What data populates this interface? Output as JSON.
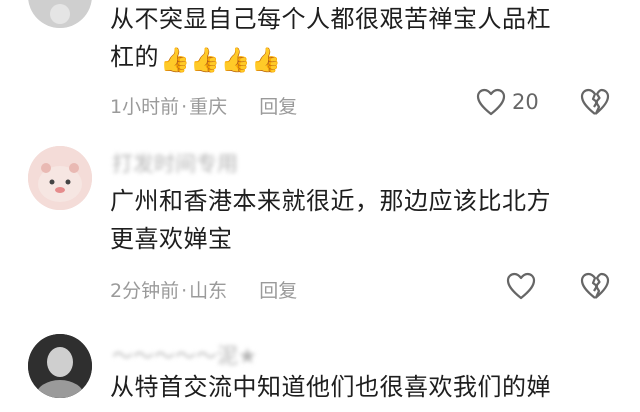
{
  "comments": [
    {
      "text_line1": "从不突显自己每个人都很艰苦禅宝人品杠",
      "text_line2": "杠的",
      "emoji": "👍",
      "meta": {
        "time": "1小时前",
        "location": "重庆",
        "reply": "回复"
      },
      "likes": "20"
    },
    {
      "username": "打发时间专用",
      "text_line1": "广州和香港本来就很近，那边应该比北方",
      "text_line2": "更喜欢婵宝",
      "meta": {
        "time": "2分钟前",
        "location": "山东",
        "reply": "回复"
      },
      "likes": ""
    },
    {
      "username": "～～～～～泥★",
      "text_line1": "从特首交流中知道他们也很喜欢我们的婵"
    }
  ],
  "icons": {
    "like": "heart-outline-icon",
    "dislike": "broken-heart-icon"
  },
  "colors": {
    "text": "#1e1e1e",
    "meta": "#9a9a9a",
    "username": "#b4b4b4",
    "icon": "#666666"
  }
}
